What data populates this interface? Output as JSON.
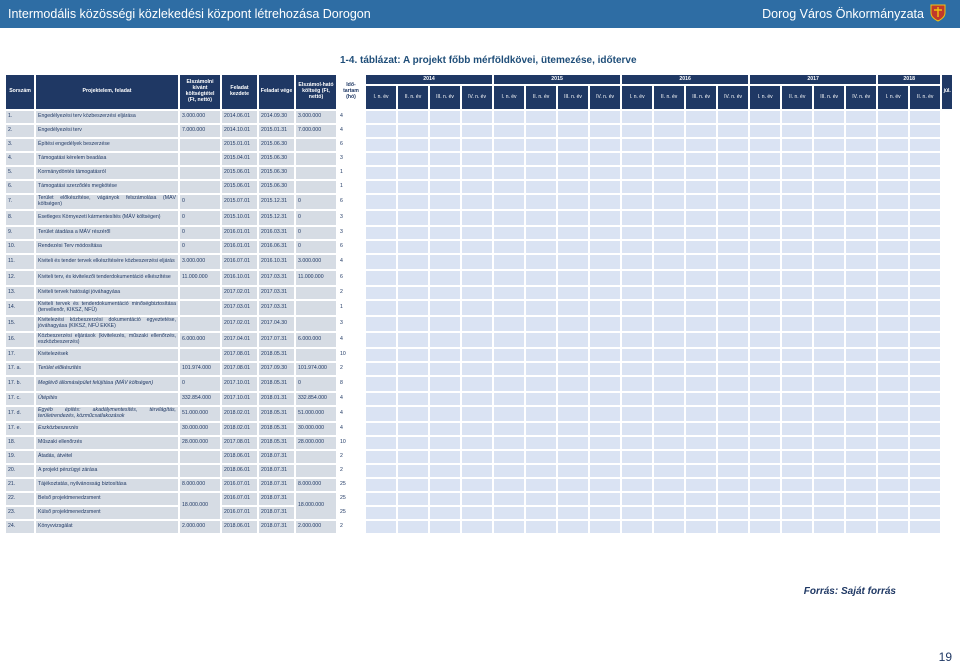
{
  "header": {
    "left": "Intermodális közösségi közlekedési központ létrehozása Dorogon",
    "right": "Dorog Város Önkormányzata",
    "crest_icon": "dorog-coat-of-arms-icon"
  },
  "caption": "1-4. táblázat: A projekt főbb mérföldkövei, ütemezése, időterve",
  "table": {
    "headers": {
      "num": "Sorszám",
      "name": "Projektelem, feladat",
      "cost": "Elszámolni kívánt költségtétel (Ft, nettó)",
      "start": "Feladat kezdete",
      "end": "Feladat vége",
      "eligible": "Elszámol-ható költség (Ft, nettó)",
      "dur": "Idő-tartam (hó)"
    },
    "years": [
      {
        "label": "2014",
        "span": 4
      },
      {
        "label": "2015",
        "span": 4
      },
      {
        "label": "2016",
        "span": 4
      },
      {
        "label": "2017",
        "span": 4
      },
      {
        "label": "2018",
        "span": 2
      }
    ],
    "quarters": [
      "I. n. év",
      "II. n. év",
      "III. n. év",
      "IV. n. év",
      "I. n. év",
      "II. n. év",
      "III. n. év",
      "IV. n. év",
      "I. n. év",
      "II. n. év",
      "III. n. év",
      "IV. n. év",
      "I. n. év",
      "II. n. év",
      "III. n. év",
      "IV. n. év",
      "I. n. év",
      "II. n. év"
    ],
    "last_col": "júl.",
    "rows": [
      {
        "num": "1.",
        "name": "Engedélyezési terv közbeszerzési eljárása",
        "cost": "3.000.000",
        "start": "2014.06.01",
        "end": "2014.09.30",
        "eligible": "3.000.000",
        "dur": "4",
        "active": []
      },
      {
        "num": "2.",
        "name": "Engedélyezési terv",
        "cost": "7.000.000",
        "start": "2014.10.01",
        "end": "2015.01.31",
        "eligible": "7.000.000",
        "dur": "4",
        "active": []
      },
      {
        "num": "3.",
        "name": "Építési engedélyek beszerzése",
        "cost": "",
        "start": "2015.01.01",
        "end": "2015.06.30",
        "eligible": "",
        "dur": "6",
        "active": []
      },
      {
        "num": "4.",
        "name": "Támogatási kérelem beadása",
        "cost": "",
        "start": "2015.04.01",
        "end": "2015.06.30",
        "eligible": "",
        "dur": "3",
        "active": []
      },
      {
        "num": "5.",
        "name": "Kormánydöntés támogatásról",
        "cost": "",
        "start": "2015.06.01",
        "end": "2015.06.30",
        "eligible": "",
        "dur": "1",
        "active": []
      },
      {
        "num": "6.",
        "name": "Támogatási szerződés megkötése",
        "cost": "",
        "start": "2015.06.01",
        "end": "2015.06.30",
        "eligible": "",
        "dur": "1",
        "active": []
      },
      {
        "num": "7.",
        "name": "Terület előkészítése, vágányok felszámolása (MÁV költségen)",
        "cost": "0",
        "start": "2015.07.01",
        "end": "2015.12.31",
        "eligible": "0",
        "dur": "6",
        "active": []
      },
      {
        "num": "8.",
        "name": "Esetleges Környezeti kármentesítés (MÁV költségen)",
        "cost": "0",
        "start": "2015.10.01",
        "end": "2015.12.31",
        "eligible": "0",
        "dur": "3",
        "active": []
      },
      {
        "num": "9.",
        "name": "Terület átadása a MÁV részéről",
        "cost": "0",
        "start": "2016.01.01",
        "end": "2016.03.31",
        "eligible": "0",
        "dur": "3",
        "active": []
      },
      {
        "num": "10.",
        "name": "Rendezési Terv módosítása",
        "cost": "0",
        "start": "2016.01.01",
        "end": "2016.06.31",
        "eligible": "0",
        "dur": "6",
        "active": []
      },
      {
        "num": "11.",
        "name": "Kiviteli és tender tervek elkészítésére közbeszerzési eljárás",
        "cost": "3.000.000",
        "start": "2016.07.01",
        "end": "2016.10.31",
        "eligible": "3.000.000",
        "dur": "4",
        "active": []
      },
      {
        "num": "12.",
        "name": "Kiviteli terv, és kivitelezői tenderdokumentáció elkészítése",
        "cost": "11.000.000",
        "start": "2016.10.01",
        "end": "2017.03.31",
        "eligible": "11.000.000",
        "dur": "6",
        "active": []
      },
      {
        "num": "13.",
        "name": "Kiviteli tervek hatósági jóváhagyása",
        "cost": "",
        "start": "2017.02.01",
        "end": "2017.03.31",
        "eligible": "",
        "dur": "2",
        "active": []
      },
      {
        "num": "14.",
        "name": "Kiviteli tervek és tenderdokumentáció minőségbiztosítása (tervellenőr, KIKSZ, NFÜ)",
        "cost": "",
        "start": "2017.03.01",
        "end": "2017.03.31",
        "eligible": "",
        "dur": "1",
        "active": []
      },
      {
        "num": "15.",
        "name": "Kivitelezési közbeszerzési dokumentáció egyeztetése, jóváhagyása (KIKSZ, NFÜ EKKE)",
        "cost": "",
        "start": "2017.02.01",
        "end": "2017.04.30",
        "eligible": "",
        "dur": "3",
        "active": []
      },
      {
        "num": "16.",
        "name": "Közbeszerzési eljárások (kivitelezés, műszaki ellenőrzés, eszközbeszerzés)",
        "cost": "6.000.000",
        "start": "2017.04.01",
        "end": "2017.07.31",
        "eligible": "6.000.000",
        "dur": "4",
        "active": []
      },
      {
        "num": "17.",
        "name": "Kivitelezések",
        "cost": "",
        "start": "2017.08.01",
        "end": "2018.05.31",
        "eligible": "",
        "dur": "10",
        "active": []
      },
      {
        "num": "17. a.",
        "name": "Terület előkészítés",
        "cost": "101.974.000",
        "start": "2017.08.01",
        "end": "2017.09.30",
        "eligible": "101.974.000",
        "dur": "2",
        "sub": true,
        "active": []
      },
      {
        "num": "17. b.",
        "name": "Meglévő állomásépület felújítása (MÁV költségen)",
        "cost": "0",
        "start": "2017.10.01",
        "end": "2018.05.31",
        "eligible": "0",
        "dur": "8",
        "sub": true,
        "active": []
      },
      {
        "num": "17. c.",
        "name": "Útépítés",
        "cost": "332.854.000",
        "start": "2017.10.01",
        "end": "2018.01.31",
        "eligible": "332.854.000",
        "dur": "4",
        "sub": true,
        "active": []
      },
      {
        "num": "17. d.",
        "name": "Egyéb építés: akadálymentesítés, térvilágítás, területrendezés, közműcsatlakozások",
        "cost": "51.000.000",
        "start": "2018.02.01",
        "end": "2018.05.31",
        "eligible": "51.000.000",
        "dur": "4",
        "sub": true,
        "active": []
      },
      {
        "num": "17. e.",
        "name": "Eszközbeszerzés",
        "cost": "30.000.000",
        "start": "2018.02.01",
        "end": "2018.05.31",
        "eligible": "30.000.000",
        "dur": "4",
        "sub": true,
        "active": []
      },
      {
        "num": "18.",
        "name": "Műszaki ellenőrzés",
        "cost": "28.000.000",
        "start": "2017.08.01",
        "end": "2018.05.31",
        "eligible": "28.000.000",
        "dur": "10",
        "active": []
      },
      {
        "num": "19.",
        "name": "Átadás, átvétel",
        "cost": "",
        "start": "2018.06.01",
        "end": "2018.07.31",
        "eligible": "",
        "dur": "2",
        "active": []
      },
      {
        "num": "20.",
        "name": "A projekt pénzügyi zárása",
        "cost": "",
        "start": "2018.06.01",
        "end": "2018.07.31",
        "eligible": "",
        "dur": "2",
        "active": []
      },
      {
        "num": "21.",
        "name": "Tájékoztatás, nyilvánosság biztosítása",
        "cost": "8.000.000",
        "start": "2016.07.01",
        "end": "2018.07.31",
        "eligible": "8.000.000",
        "dur": "25",
        "active": []
      },
      {
        "num": "22.",
        "name": "Belső projektmenedzsment",
        "cost": "18.000.000",
        "start": "2016.07.01",
        "end": "2018.07.31",
        "eligible": "18.000.000",
        "dur": "25",
        "merge_first": true,
        "active": []
      },
      {
        "num": "23.",
        "name": "Külső projektmenedzsment",
        "cost": "",
        "start": "2016.07.01",
        "end": "2018.07.31",
        "eligible": "",
        "dur": "25",
        "merged": true,
        "active": []
      },
      {
        "num": "24.",
        "name": "Könyvvizsgálat",
        "cost": "2.000.000",
        "start": "2018.06.01",
        "end": "2018.07.31",
        "eligible": "2.000.000",
        "dur": "2",
        "active": []
      }
    ]
  },
  "source": "Forrás: Saját forrás",
  "page_number": "19"
}
